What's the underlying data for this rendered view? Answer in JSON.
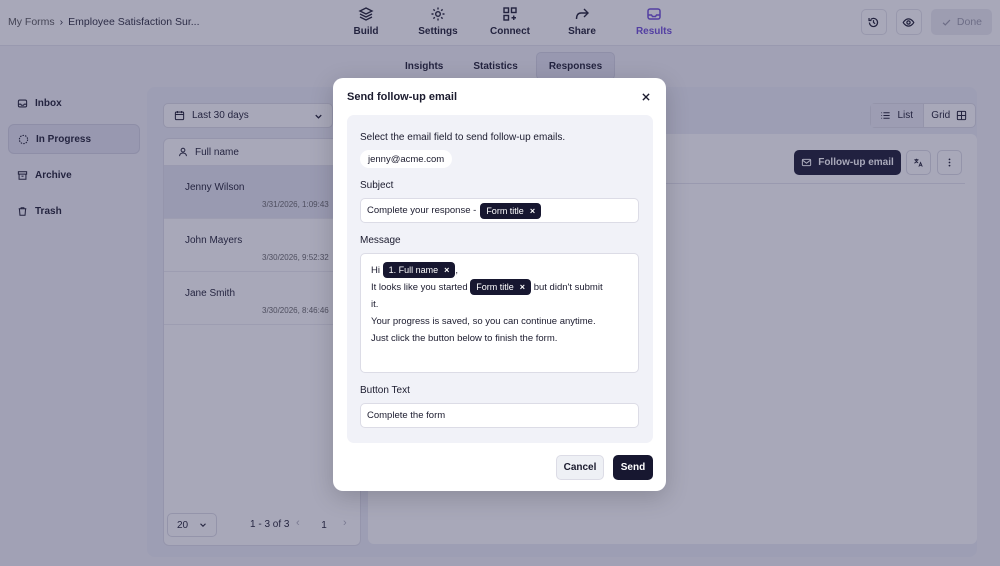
{
  "breadcrumb": {
    "root": "My Forms",
    "separator": "›",
    "current": "Employee Satisfaction Sur..."
  },
  "nav": [
    {
      "label": "Build",
      "icon": "layers-icon"
    },
    {
      "label": "Settings",
      "icon": "gear-icon"
    },
    {
      "label": "Connect",
      "icon": "connect-icon"
    },
    {
      "label": "Share",
      "icon": "share-icon"
    },
    {
      "label": "Results",
      "icon": "inbox-icon",
      "active": true
    }
  ],
  "top_actions": {
    "done_label": "Done"
  },
  "subtabs": [
    "Insights",
    "Statistics",
    "Responses"
  ],
  "sidebar": {
    "items": [
      {
        "label": "Inbox",
        "icon": "inbox-icon"
      },
      {
        "label": "In Progress",
        "icon": "progress-icon",
        "active": true
      },
      {
        "label": "Archive",
        "icon": "archive-icon"
      },
      {
        "label": "Trash",
        "icon": "trash-icon"
      }
    ]
  },
  "filters": {
    "date_range": "Last 30 days"
  },
  "list": {
    "column_header": "Full name",
    "rows": [
      {
        "name": "Jenny Wilson",
        "date": "3/31/2026, 1:09:43"
      },
      {
        "name": "John Mayers",
        "date": "3/30/2026, 9:52:32"
      },
      {
        "name": "Jane Smith",
        "date": "3/30/2026, 8:46:46"
      }
    ]
  },
  "pagination": {
    "per_page": "20",
    "range": "1 - 3 of 3",
    "page": "1",
    "prev": "‹",
    "next": "›"
  },
  "view_toggle": {
    "list_label": "List",
    "grid_label": "Grid"
  },
  "detail": {
    "followup_label": "Follow-up email"
  },
  "modal": {
    "title": "Send follow-up email",
    "hint": "Select the email field to send follow-up emails.",
    "email_chip": "jenny@acme.com",
    "subject_label": "Subject",
    "subject_prefix": "Complete your response -",
    "subject_tag": "Form title",
    "message_label": "Message",
    "message": {
      "hi": "Hi",
      "name_tag": "1. Full name",
      "comma": ",",
      "line2_pre": "It looks like you started",
      "form_tag": "Form title",
      "line2_post": "but didn't submit",
      "line3": "it.",
      "line4": "Your progress is saved, so you can continue anytime.",
      "line5": "Just click the button below to finish the form."
    },
    "button_text_label": "Button Text",
    "button_text_value": "Complete the form",
    "cancel_label": "Cancel",
    "send_label": "Send"
  },
  "tag_remove": "×",
  "colors": {
    "accent": "#6d4bd8",
    "dark": "#171730",
    "overlay": "#303058"
  }
}
